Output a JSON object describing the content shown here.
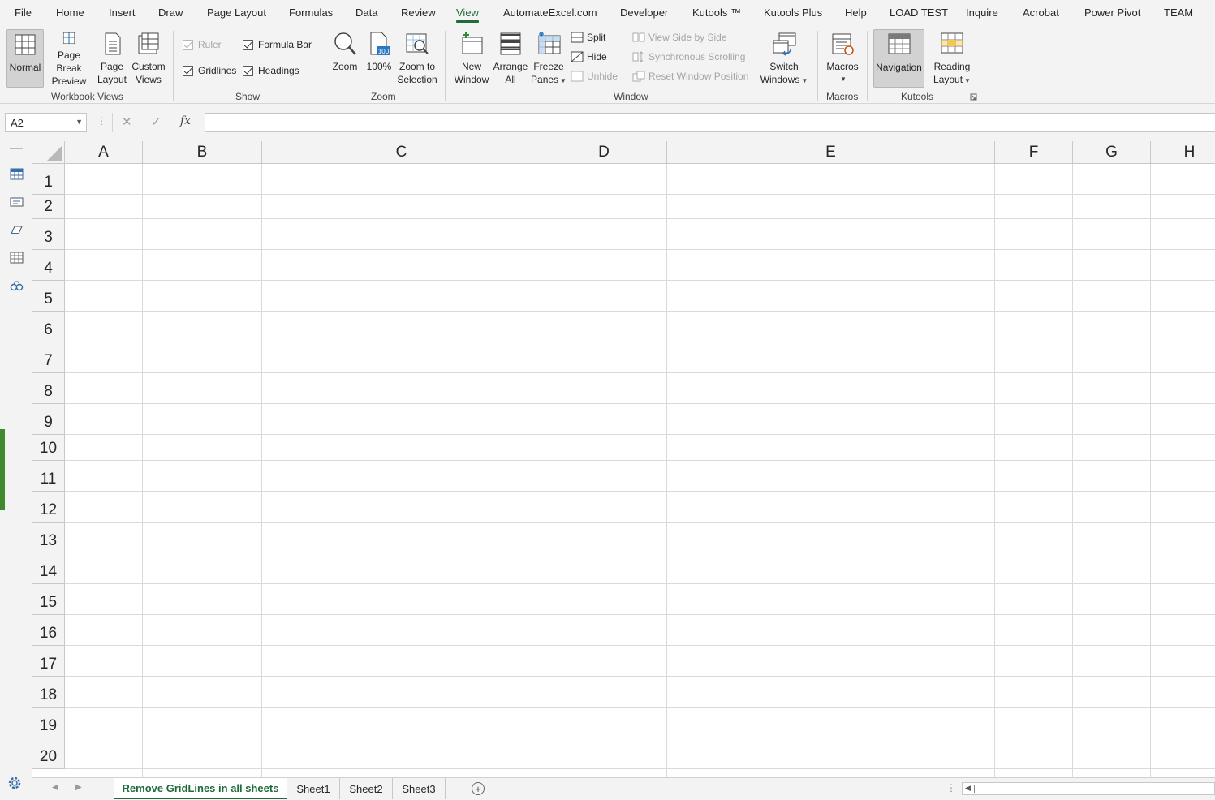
{
  "menu": {
    "tabs": [
      "File",
      "Home",
      "Insert",
      "Draw",
      "Page Layout",
      "Formulas",
      "Data",
      "Review",
      "View",
      "AutomateExcel.com",
      "Developer",
      "Kutools ™",
      "Kutools Plus",
      "Help",
      "LOAD TEST",
      "Inquire",
      "Acrobat",
      "Power Pivot",
      "TEAM"
    ],
    "active": "View"
  },
  "ribbon": {
    "workbook_views": {
      "label": "Workbook Views",
      "normal": "Normal",
      "page_break": [
        "Page Break",
        "Preview"
      ],
      "page_layout": [
        "Page",
        "Layout"
      ],
      "custom_views": [
        "Custom",
        "Views"
      ]
    },
    "show": {
      "label": "Show",
      "ruler": "Ruler",
      "formula_bar": "Formula Bar",
      "gridlines": "Gridlines",
      "headings": "Headings"
    },
    "zoom": {
      "label": "Zoom",
      "zoom": "Zoom",
      "hundred": "100%",
      "zoom_selection": [
        "Zoom to",
        "Selection"
      ],
      "hundred_icon_text": "100"
    },
    "window": {
      "label": "Window",
      "new_window": [
        "New",
        "Window"
      ],
      "arrange_all": [
        "Arrange",
        "All"
      ],
      "freeze_panes": [
        "Freeze",
        "Panes"
      ],
      "split": "Split",
      "hide": "Hide",
      "unhide": "Unhide",
      "view_side": "View Side by Side",
      "sync_scroll": "Synchronous Scrolling",
      "reset_pos": "Reset Window Position",
      "switch_windows": [
        "Switch",
        "Windows"
      ]
    },
    "macros": {
      "label": "Macros",
      "macros": "Macros"
    },
    "kutools": {
      "label": "Kutools",
      "navigation": "Navigation",
      "reading_layout": [
        "Reading",
        "Layout"
      ]
    }
  },
  "formula_bar": {
    "name_box": "A2",
    "value": "",
    "fx": "fx"
  },
  "grid": {
    "columns": [
      "A",
      "B",
      "C",
      "D",
      "E",
      "F",
      "G",
      "H"
    ],
    "rows": [
      "1",
      "2",
      "3",
      "4",
      "5",
      "6",
      "7",
      "8",
      "9",
      "10",
      "11",
      "12",
      "13",
      "14",
      "15",
      "16",
      "17",
      "18",
      "19",
      "20"
    ]
  },
  "sheets": {
    "tabs": [
      "Remove GridLines in all sheets",
      "Sheet1",
      "Sheet2",
      "Sheet3"
    ],
    "active": "Remove GridLines in all sheets"
  },
  "colors": {
    "accent": "#1e6b3c",
    "ribbon_bg": "#f3f3f3",
    "gridline": "#dadada",
    "side_indicator": "#3f8a2d"
  }
}
